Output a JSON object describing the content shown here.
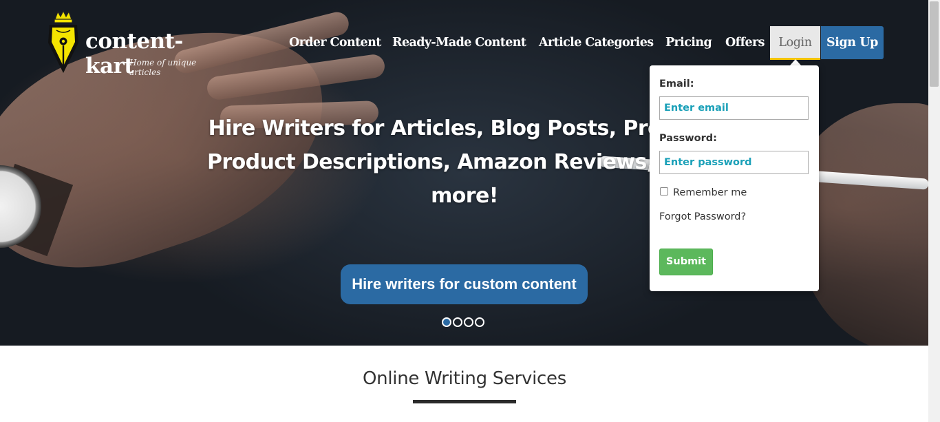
{
  "brand": {
    "name": "content-kart",
    "tagline": "Home of unique articles",
    "logo_icon": "pen-nib-crown-icon",
    "colors": {
      "primary": "#2b6aa3",
      "accent_yellow": "#f4e400",
      "success": "#5cb85c"
    }
  },
  "nav": {
    "items": [
      {
        "label": "Order Content"
      },
      {
        "label": "Ready-Made Content"
      },
      {
        "label": "Article Categories"
      },
      {
        "label": "Pricing"
      },
      {
        "label": "Offers"
      }
    ],
    "login_label": "Login",
    "signup_label": "Sign Up"
  },
  "hero": {
    "headline_lines": [
      "Hire Writers for Articles, Blog Posts, Press Re",
      "Product Descriptions, Amazon Reviews, News",
      "more!"
    ],
    "cta_label": "Hire writers for custom content",
    "slides_total": 4,
    "active_slide": 1
  },
  "login_form": {
    "email_label": "Email:",
    "email_placeholder": "Enter email",
    "password_label": "Password:",
    "password_placeholder": "Enter password",
    "remember_label": "Remember me",
    "remember_checked": false,
    "forgot_label": "Forgot Password?",
    "submit_label": "Submit"
  },
  "services": {
    "title": "Online Writing Services"
  }
}
